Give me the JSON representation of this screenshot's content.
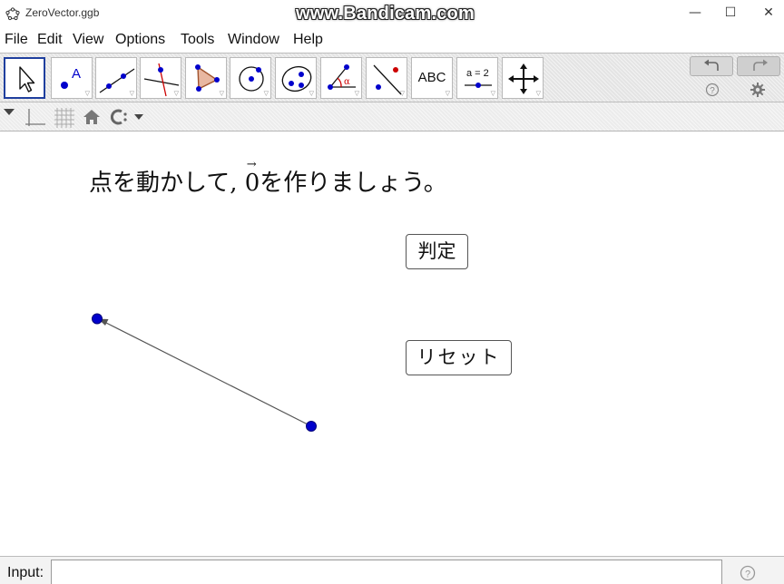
{
  "window": {
    "title": "ZeroVector.ggb",
    "watermark": "www.Bandicam.com",
    "min_glyph": "—",
    "max_glyph": "☐",
    "close_glyph": "✕"
  },
  "menu": {
    "items": [
      "File",
      "Edit",
      "View",
      "Options",
      "Tools",
      "Window",
      "Help"
    ]
  },
  "toolbar": {
    "tools": [
      {
        "name": "move-tool",
        "icon": "cursor-icon",
        "selected": true
      },
      {
        "name": "point-tool",
        "icon": "point-icon",
        "label": "A"
      },
      {
        "name": "line-tool",
        "icon": "line-icon"
      },
      {
        "name": "perpendicular-line-tool",
        "icon": "perpendicular-icon"
      },
      {
        "name": "polygon-tool",
        "icon": "polygon-icon"
      },
      {
        "name": "circle-tool",
        "icon": "circle-icon"
      },
      {
        "name": "conic-tool",
        "icon": "ellipse-icon"
      },
      {
        "name": "angle-tool",
        "icon": "angle-icon",
        "label": "α"
      },
      {
        "name": "reflect-tool",
        "icon": "reflect-icon"
      },
      {
        "name": "text-tool",
        "icon": "text-icon",
        "label": "ABC"
      },
      {
        "name": "slider-tool",
        "icon": "slider-icon",
        "label": "a = 2"
      },
      {
        "name": "move-graphics-tool",
        "icon": "move-arrows-icon"
      }
    ],
    "undo_icon": "undo-icon",
    "redo_icon": "redo-icon",
    "help_icon": "help-icon",
    "settings_icon": "gear-icon"
  },
  "canvas": {
    "instruction_before": "点を動かして, ",
    "zero_symbol": "0",
    "arrow_symbol": "→",
    "instruction_after": "を作りましょう。",
    "judge_button": "判定",
    "reset_button": "リセット",
    "point_color": "#0000cc",
    "vector_color": "#555555"
  },
  "inputbar": {
    "label": "Input:",
    "value": "",
    "help_icon": "help-icon"
  },
  "colors": {
    "selected_tool_border": "#1f3f9e",
    "point_fill": "#0000cc"
  }
}
